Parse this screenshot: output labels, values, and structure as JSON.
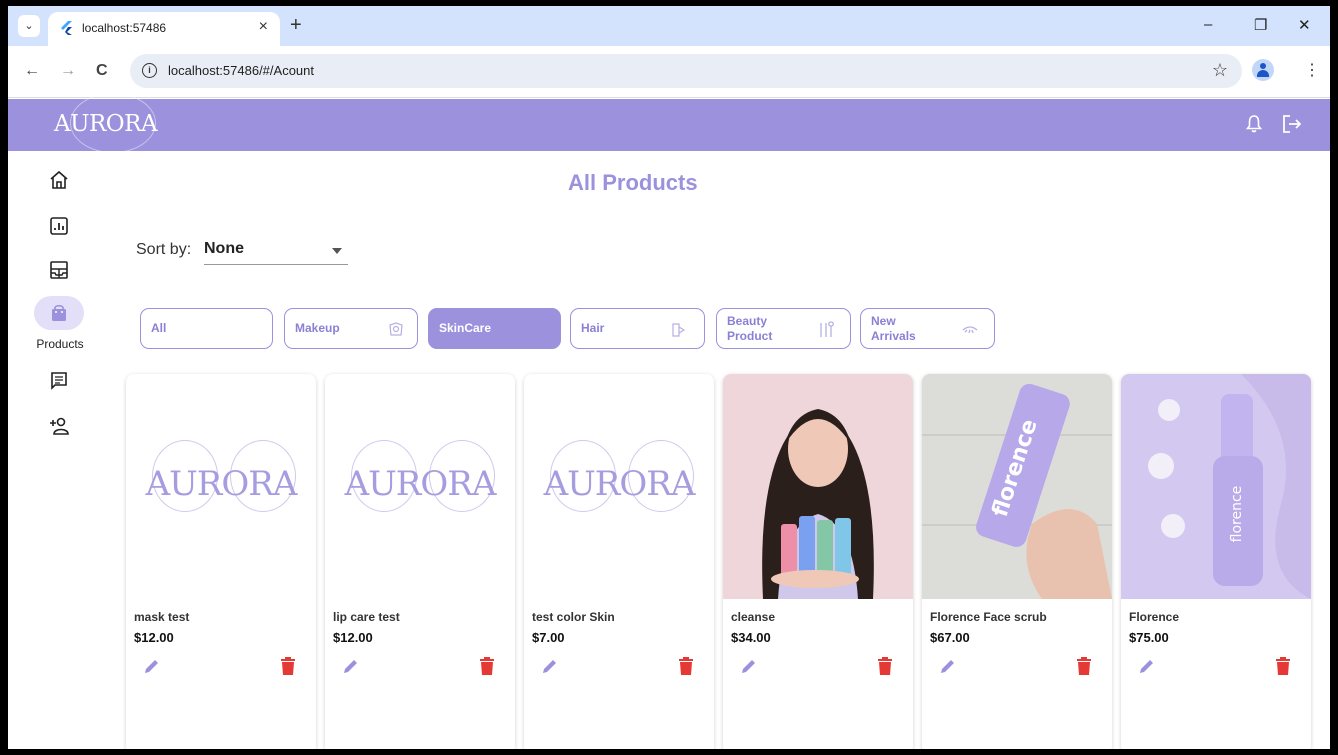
{
  "browser": {
    "tab_title": "localhost:57486",
    "url": "localhost:57486/#/Acount",
    "tab_close": "×",
    "new_tab": "+",
    "tab_menu": "⌄",
    "win_minimize": "–",
    "win_restore": "❐",
    "win_close": "✕",
    "back": "←",
    "forward": "→",
    "reload": "C",
    "star": "☆",
    "info": "i",
    "kebab": "⋮"
  },
  "header": {
    "brand": "AURORA",
    "brand_color": "#9b91dd",
    "icons": [
      "bell-icon",
      "logout-icon"
    ]
  },
  "sidebar": {
    "items": [
      {
        "name": "home-icon"
      },
      {
        "name": "analytics-icon"
      },
      {
        "name": "dashboard-icon"
      },
      {
        "name": "shopping-bag-icon",
        "label": "Products",
        "active": true
      },
      {
        "name": "messages-icon"
      },
      {
        "name": "add-user-icon"
      }
    ]
  },
  "main": {
    "title": "All Products",
    "sort": {
      "label": "Sort by:",
      "value": "None"
    },
    "categories": [
      {
        "label": "All",
        "icon": "",
        "active": false
      },
      {
        "label": "Makeup",
        "icon": "makeup-icon",
        "active": false
      },
      {
        "label": "SkinCare",
        "icon": "",
        "active": true
      },
      {
        "label": "Hair",
        "icon": "hair-icon",
        "active": false
      },
      {
        "label": "Beauty Product",
        "line1": "Beauty",
        "line2": "Product",
        "icon": "brushes-icon",
        "active": false
      },
      {
        "label": "New Arrivals",
        "line1": "New",
        "line2": "Arrivals",
        "icon": "eye-icon",
        "active": false
      }
    ],
    "products": [
      {
        "name": "mask test",
        "price": "$12.00",
        "image": "placeholder-logo",
        "placeholder_text": "AURORA"
      },
      {
        "name": "lip care test",
        "price": "$12.00",
        "image": "placeholder-logo",
        "placeholder_text": "AURORA"
      },
      {
        "name": "test color Skin",
        "price": "$7.00",
        "image": "placeholder-logo",
        "placeholder_text": "AURORA"
      },
      {
        "name": "cleanse",
        "price": "$34.00",
        "image": "model-with-bottles-photo"
      },
      {
        "name": "Florence Face scrub",
        "price": "$67.00",
        "image": "hand-holding-tube-photo",
        "image_text": "florence"
      },
      {
        "name": "Florence",
        "price": "$75.00",
        "image": "foam-bottle-photo",
        "image_text": "florence"
      }
    ],
    "edit_color": "#9b91dd",
    "delete_color": "#e53935"
  }
}
